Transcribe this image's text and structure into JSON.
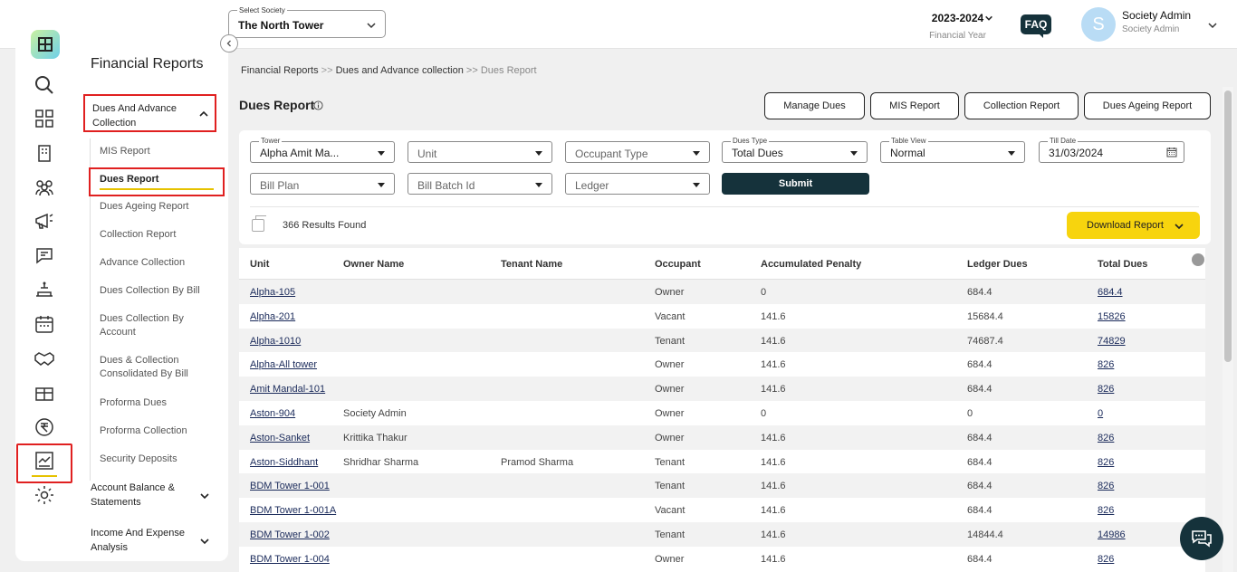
{
  "header": {
    "society_label": "Select Society",
    "society_value": "The North Tower",
    "fy_value": "2023-2024",
    "fy_sub": "Financial Year",
    "faq": "FAQ",
    "avatar_letter": "S",
    "user_name": "Society Admin",
    "user_role": "Society Admin"
  },
  "rail": {
    "icons": [
      "search-icon",
      "dashboard-icon",
      "building-icon",
      "members-icon",
      "megaphone-icon",
      "chat-icon",
      "service-icon",
      "calendar-icon",
      "handshake-icon",
      "gift-icon",
      "rupee-icon",
      "reports-chart-icon",
      "settings-gear-icon"
    ]
  },
  "subnav": {
    "title": "Financial Reports",
    "group_active": "Dues And Advance Collection",
    "items": [
      {
        "label": "MIS Report"
      },
      {
        "label": "Dues Report"
      },
      {
        "label": "Dues Ageing Report"
      },
      {
        "label": "Collection Report"
      },
      {
        "label": "Advance Collection"
      },
      {
        "label": "Dues Collection By Bill"
      },
      {
        "label": "Dues Collection By Account"
      },
      {
        "label": "Dues & Collection Consolidated By Bill"
      },
      {
        "label": "Proforma Dues"
      },
      {
        "label": "Proforma Collection"
      },
      {
        "label": "Security Deposits"
      }
    ],
    "group2": "Account Balance & Statements",
    "group3": "Income And Expense Analysis"
  },
  "breadcrumb": {
    "c1": "Financial Reports",
    "sep": ">>",
    "c2": "Dues and Advance collection",
    "c3": "Dues Report"
  },
  "page": {
    "title": "Dues Report",
    "buttons": [
      "Manage Dues",
      "MIS Report",
      "Collection Report",
      "Dues Ageing Report"
    ]
  },
  "filters": {
    "tower_label": "Tower",
    "tower_value": "Alpha Amit Ma...",
    "unit_ph": "Unit",
    "occupant_ph": "Occupant Type",
    "dues_type_label": "Dues Type",
    "dues_type_value": "Total Dues",
    "table_view_label": "Table View",
    "table_view_value": "Normal",
    "till_date_label": "Till Date",
    "till_date_value": "31/03/2024",
    "bill_plan_ph": "Bill Plan",
    "bill_batch_ph": "Bill Batch Id",
    "ledger_ph": "Ledger",
    "submit": "Submit"
  },
  "results": {
    "count_text": "366 Results Found",
    "download": "Download Report"
  },
  "table": {
    "headers": [
      "Unit",
      "Owner Name",
      "Tenant Name",
      "Occupant",
      "Accumulated Penalty",
      "Ledger Dues",
      "Total Dues"
    ],
    "rows": [
      [
        "Alpha-105",
        "",
        "",
        "Owner",
        "0",
        "684.4",
        "684.4"
      ],
      [
        "Alpha-201",
        "",
        "",
        "Vacant",
        "141.6",
        "15684.4",
        "15826"
      ],
      [
        "Alpha-1010",
        "",
        "",
        "Tenant",
        "141.6",
        "74687.4",
        "74829"
      ],
      [
        "Alpha-All tower",
        "",
        "",
        "Owner",
        "141.6",
        "684.4",
        "826"
      ],
      [
        "Amit Mandal-101",
        "",
        "",
        "Owner",
        "141.6",
        "684.4",
        "826"
      ],
      [
        "Aston-904",
        "Society Admin",
        "",
        "Owner",
        "0",
        "0",
        "0"
      ],
      [
        "Aston-Sanket",
        "Krittika Thakur",
        "",
        "Owner",
        "141.6",
        "684.4",
        "826"
      ],
      [
        "Aston-Siddhant",
        "Shridhar Sharma",
        "Pramod Sharma",
        "Tenant",
        "141.6",
        "684.4",
        "826"
      ],
      [
        "BDM Tower 1-001",
        "",
        "",
        "Tenant",
        "141.6",
        "684.4",
        "826"
      ],
      [
        "BDM Tower 1-001A",
        "",
        "",
        "Vacant",
        "141.6",
        "684.4",
        "826"
      ],
      [
        "BDM Tower 1-002",
        "",
        "",
        "Tenant",
        "141.6",
        "14844.4",
        "14986"
      ],
      [
        "BDM Tower 1-004",
        "",
        "",
        "Owner",
        "141.6",
        "684.4",
        "826"
      ]
    ]
  },
  "colors": {
    "accent_dark": "#15323b",
    "accent_yellow": "#f7d40e",
    "highlight_red": "#e02020"
  }
}
